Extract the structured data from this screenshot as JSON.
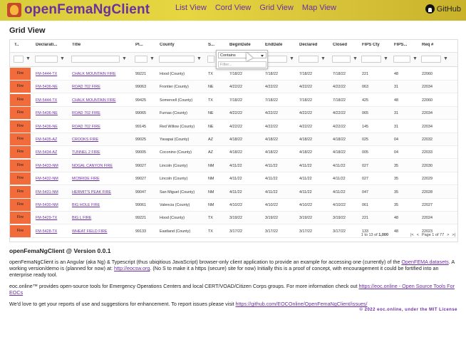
{
  "app": {
    "title": "openFemaNgClient",
    "github": "GitHub"
  },
  "nav": [
    "List View",
    "Cord View",
    "Grid View",
    "Map View"
  ],
  "page_title": "Grid View",
  "columns": [
    "T..",
    "Declarati...",
    "Title",
    "Pl...",
    "County",
    "S...",
    "BeginDate",
    "EndDate",
    "Declared",
    "Closed",
    "FIPS Cty",
    "FIPS...",
    "Req #"
  ],
  "filter_popup": {
    "operator": "Contains",
    "placeholder": "Filter..."
  },
  "rows": [
    [
      "Fire",
      "FM-5444-TX",
      "CHALK MOUNTAIN FIRE",
      "99221",
      "Hood (County)",
      "TX",
      "7/18/22",
      "7/18/22",
      "7/18/22",
      "7/18/22",
      "221",
      "48",
      "22060"
    ],
    [
      "Fire",
      "FM-5436-NE",
      "ROAD 702 FIRE",
      "99063",
      "Frontier (County)",
      "NE",
      "4/22/22",
      "4/22/22",
      "4/22/22",
      "4/22/22",
      "063",
      "31",
      "22034"
    ],
    [
      "Fire",
      "FM-5444-TX",
      "CHALK MOUNTAIN FIRE",
      "99425",
      "Somervell (County)",
      "TX",
      "7/18/22",
      "7/18/22",
      "7/18/22",
      "7/18/22",
      "425",
      "48",
      "22060"
    ],
    [
      "Fire",
      "FM-5436-NE",
      "ROAD 702 FIRE",
      "99065",
      "Furnas (County)",
      "NE",
      "4/22/22",
      "4/22/22",
      "4/22/22",
      "4/22/22",
      "065",
      "31",
      "22034"
    ],
    [
      "Fire",
      "FM-5436-NE",
      "ROAD 702 FIRE",
      "99145",
      "Red Willow (County)",
      "NE",
      "4/22/22",
      "4/22/22",
      "4/22/22",
      "4/22/22",
      "145",
      "31",
      "22034"
    ],
    [
      "Fire",
      "FM-5435-AZ",
      "CROOKS FIRE",
      "99025",
      "Yavapai (County)",
      "AZ",
      "4/18/22",
      "4/18/22",
      "4/18/22",
      "4/18/22",
      "025",
      "04",
      "22032"
    ],
    [
      "Fire",
      "FM-5434-AZ",
      "TUNNEL 2 FIRE",
      "99005",
      "Coconino (County)",
      "AZ",
      "4/18/22",
      "4/18/22",
      "4/18/22",
      "4/18/22",
      "005",
      "04",
      "22033"
    ],
    [
      "Fire",
      "FM-5433-NM",
      "NOGAL CANYON FIRE",
      "99027",
      "Lincoln (County)",
      "NM",
      "4/11/22",
      "4/11/22",
      "4/11/22",
      "4/11/22",
      "027",
      "35",
      "22030"
    ],
    [
      "Fire",
      "FM-5432-NM",
      "MCBRIDE FIRE",
      "99027",
      "Lincoln (County)",
      "NM",
      "4/11/22",
      "4/11/22",
      "4/11/22",
      "4/11/22",
      "027",
      "35",
      "22029"
    ],
    [
      "Fire",
      "FM-5431-NM",
      "HERMIT'S PEAK FIRE",
      "99047",
      "San Miguel (County)",
      "NM",
      "4/11/22",
      "4/11/22",
      "4/11/22",
      "4/11/22",
      "047",
      "35",
      "22028"
    ],
    [
      "Fire",
      "FM-5430-NM",
      "BIG HOLE FIRE",
      "99061",
      "Valencia (County)",
      "NM",
      "4/10/22",
      "4/10/22",
      "4/10/22",
      "4/10/22",
      "061",
      "35",
      "22027"
    ],
    [
      "Fire",
      "FM-5429-TX",
      "BIG L FIRE",
      "99221",
      "Hood (County)",
      "TX",
      "3/19/22",
      "3/19/22",
      "3/19/22",
      "3/19/22",
      "221",
      "48",
      "22024"
    ],
    [
      "Fire",
      "FM-5428-TX",
      "WHEAT FIELD FIRE",
      "99133",
      "Eastland (County)",
      "TX",
      "3/17/22",
      "3/17/22",
      "3/17/22",
      "3/17/22",
      "133",
      "48",
      "22023"
    ]
  ],
  "pager": {
    "summary_prefix": "1 to 13 of",
    "total": "1,000",
    "page_text": "Page 1 of 77"
  },
  "footer": {
    "heading": "openFemaNgClient @ Version 0.0.1",
    "p1": "openFemaNgClient is an Angular (aka Ng) & Typescript (thus ubiqitious JavaScript) browser-only client application to provide an example for accessing one (currently) of the",
    "p1_link": "OpenFEMA datasets",
    "p1_rest": ". A working version/demo is (planned for now) at:",
    "p1_link2": "http://eocsw.org",
    "p1_rest2": ". (No S to make it a https (secure) site for now) Initially this is a proof of concept, with encouragement it could be fortified into an enterprise ready tool.",
    "p2": "eoc.online™ provides open-source tools for Emergency Operations Centers and local CERT/VOAD/Citizen Corps groups. For more information check out",
    "p2_link": "https://eoc.online - Open Source Tools For EOCs",
    "p3": "We'd love to get your reports of use and suggestions for enhancement. To report issues please visit",
    "p3_link": "https://github.com/EOCOnline/OpenFemaNgClient/issues/",
    "copyright": "© 2022 eoc.online, under the MIT License"
  }
}
